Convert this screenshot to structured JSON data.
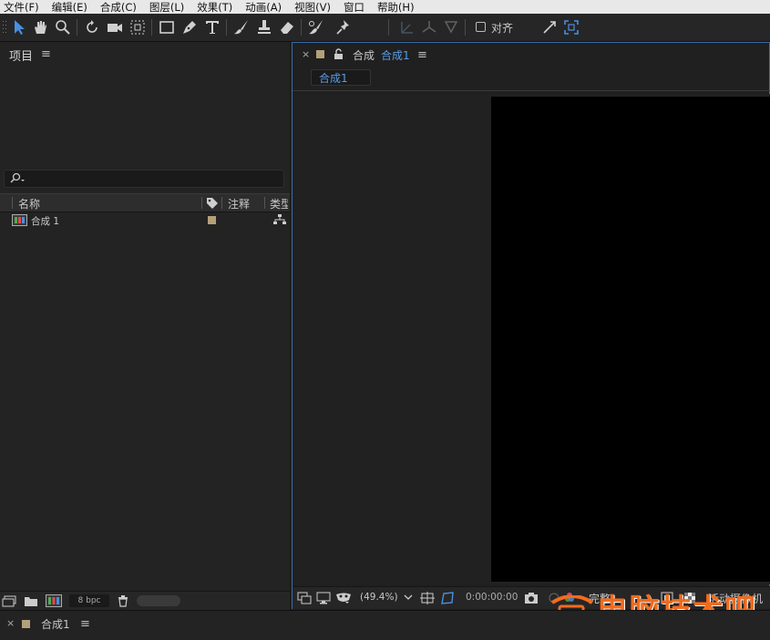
{
  "menu": [
    "文件(F)",
    "编辑(E)",
    "合成(C)",
    "图层(L)",
    "效果(T)",
    "动画(A)",
    "视图(V)",
    "窗口",
    "帮助(H)"
  ],
  "toolbar": {
    "tools": [
      "selection-tool",
      "hand-tool",
      "zoom-tool",
      "rotate-tool",
      "camera-tool",
      "pan-behind-tool",
      "rectangle-tool",
      "pen-tool",
      "type-tool",
      "brush-tool",
      "clone-stamp-tool",
      "eraser-tool",
      "roto-brush-tool",
      "puppet-pin-tool"
    ],
    "snap_label": "对齐"
  },
  "project": {
    "title": "项目",
    "search_placeholder": "",
    "columns": {
      "name": "名称",
      "comment": "注释",
      "type": "类型"
    },
    "items": [
      {
        "name": "合成 1",
        "label_color": "#b59f7a"
      }
    ],
    "bpc": "8 bpc"
  },
  "comp_panel": {
    "prefix": "合成",
    "name": "合成1",
    "breadcrumb": "合成1",
    "zoom": "(49.4%)",
    "timecode": "0:00:00:00",
    "resolution": "完整",
    "camera": "活动摄像机"
  },
  "timeline": {
    "tab": "合成1"
  },
  "watermark": "电脑技术吧",
  "colors": {
    "accent": "#3d6ea8",
    "label": "#b59f7a",
    "watermark": "#f26b1d"
  }
}
